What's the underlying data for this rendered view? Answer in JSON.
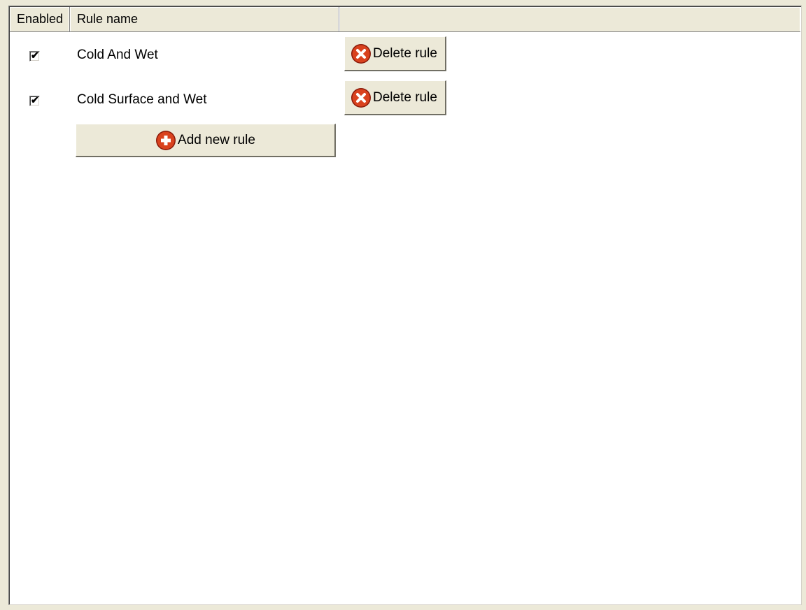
{
  "table": {
    "columns": [
      "Enabled",
      "Rule name",
      ""
    ],
    "rows": [
      {
        "enabled": true,
        "name": "Cold And Wet",
        "delete_label": "Delete rule"
      },
      {
        "enabled": true,
        "name": "Cold Surface and Wet",
        "delete_label": "Delete rule"
      }
    ],
    "add_label": "Add new rule"
  },
  "icons": {
    "delete": "delete-circle-icon",
    "add": "add-circle-icon"
  },
  "colors": {
    "button_face": "#ece9d8",
    "icon_red": "#d23a1a"
  }
}
